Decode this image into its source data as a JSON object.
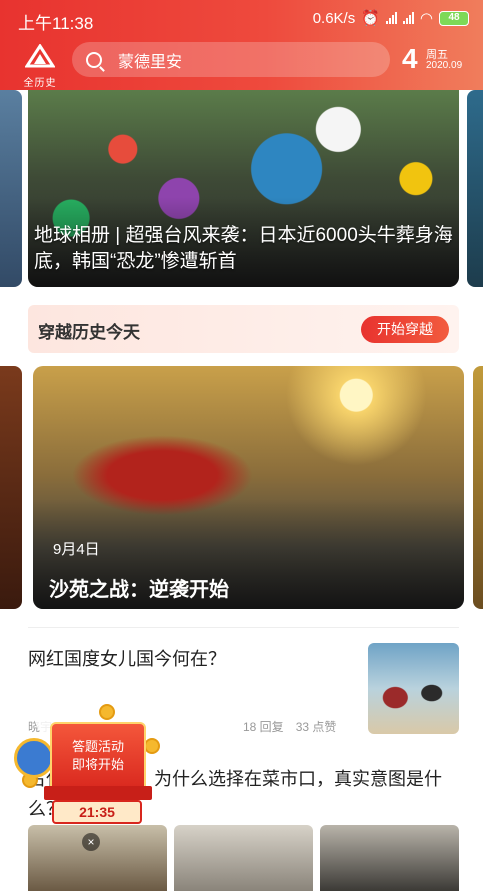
{
  "status_bar": {
    "time": "上午11:38",
    "network_speed": "0.6K/s",
    "battery": "48",
    "icons": [
      "alarm-icon",
      "signal-icon",
      "signal-icon",
      "wifi-icon",
      "battery-icon"
    ]
  },
  "header": {
    "logo_label": "全历史",
    "search_placeholder": "蒙德里安",
    "date_day": "4",
    "date_weekday": "周五",
    "date_year_month": "2020.09"
  },
  "feature": {
    "title": "地球相册 | 超强台风来袭：日本近6000头牛葬身海底，韩国“恐龙”惨遭斩首"
  },
  "history": {
    "label": "穿越历史今天",
    "button": "开始穿越",
    "card_date": "9月4日",
    "card_title": "沙苑之战：逆袭开始"
  },
  "articles": [
    {
      "title": "网红国度女儿国今何在？",
      "source": "晓宇",
      "replies": "18 回复",
      "likes": "33 点赞"
    },
    {
      "title": "古代处决犯时，为什么选择在菜市口，真实意图是什么？"
    }
  ],
  "quiz": {
    "line1": "答题活动",
    "line2": "即将开始",
    "timer": "21:35",
    "close": "×"
  },
  "colors": {
    "brand_red": "#e8332f",
    "brand_orange": "#f07d5c"
  }
}
